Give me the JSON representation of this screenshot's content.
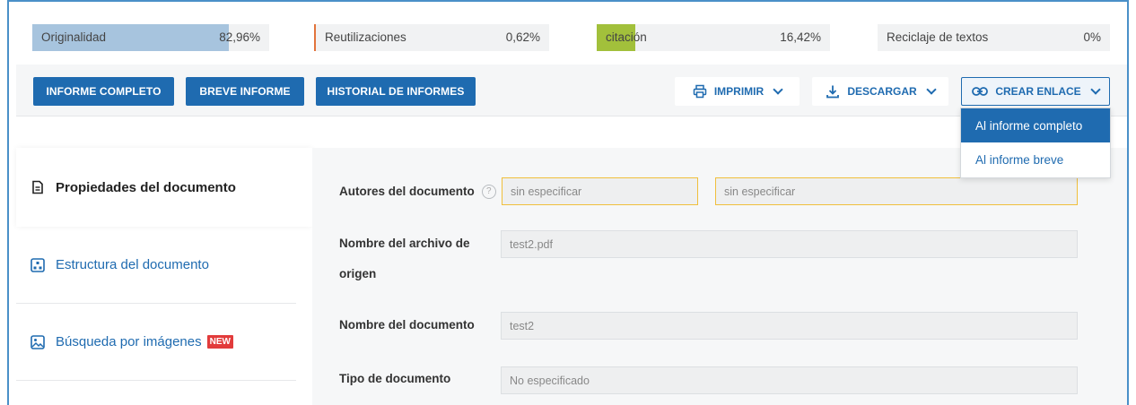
{
  "metrics": [
    {
      "name": "Originalidad",
      "value": "82,96%",
      "fill_percent": 82.96,
      "color": "#a7c4de"
    },
    {
      "name": "Reutilizaciones",
      "value": "0,62%",
      "fill_percent": 0.62,
      "color": "#e2743c"
    },
    {
      "name": "citación",
      "value": "16,42%",
      "fill_percent": 16.42,
      "color": "#a2c03b"
    },
    {
      "name": "Reciclaje de textos",
      "value": "0%",
      "fill_percent": 0,
      "color": "#f1f2f3"
    }
  ],
  "toolbar": {
    "full_report": "INFORME COMPLETO",
    "brief_report": "BREVE INFORME",
    "report_history": "HISTORIAL DE INFORMES",
    "print": "IMPRIMIR",
    "download": "DESCARGAR",
    "create_link": "CREAR ENLACE"
  },
  "dropdown": {
    "items": [
      "Al informe completo",
      "Al informe breve"
    ]
  },
  "sidebar": {
    "items": [
      {
        "label": "Propiedades del documento",
        "icon": "document-icon"
      },
      {
        "label": "Estructura del documento",
        "icon": "structure-icon"
      },
      {
        "label": "Búsqueda por imágenes",
        "icon": "image-icon",
        "badge": "NEW"
      }
    ]
  },
  "form": {
    "authors_label": "Autores del documento",
    "help": "?",
    "authors_placeholder_1": "sin especificar",
    "authors_placeholder_2": "sin especificar",
    "source_file_label": "Nombre del archivo de origen",
    "source_file_value": "test2.pdf",
    "doc_name_label": "Nombre del documento",
    "doc_name_value": "test2",
    "doc_type_label": "Tipo de documento",
    "doc_type_value": "No especificado"
  },
  "colors": {
    "accent": "#1f6bb0",
    "warning_border": "#f0bf3c",
    "badge": "#e23b3b"
  }
}
